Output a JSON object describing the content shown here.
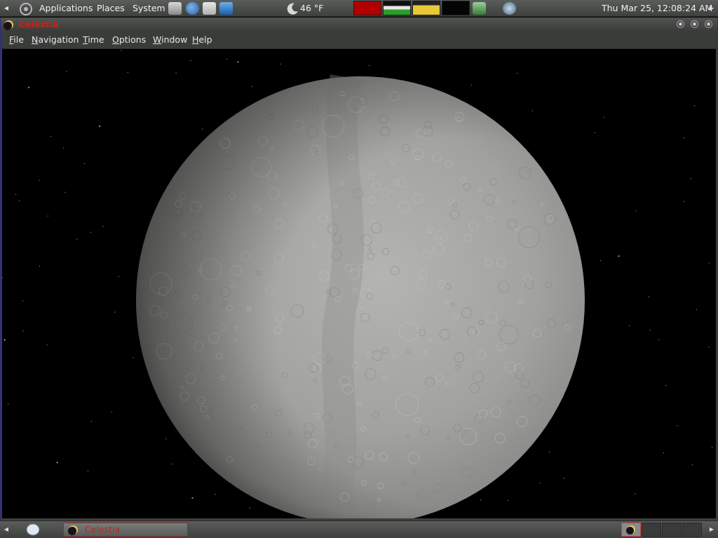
{
  "top_panel": {
    "menus": {
      "applications": "Applications",
      "places": "Places",
      "system": "System"
    },
    "weather": "46 °F",
    "clock": "Thu Mar 25, 12:08:24 AM"
  },
  "window": {
    "title": "Celestia",
    "menubar": {
      "file": {
        "m": "F",
        "r": "ile"
      },
      "navigation": {
        "m": "N",
        "r": "avigation"
      },
      "time": {
        "m": "T",
        "r": "ime"
      },
      "options": {
        "m": "O",
        "r": "ptions"
      },
      "window": {
        "m": "W",
        "r": "indow"
      },
      "help": {
        "m": "H",
        "r": "elp"
      }
    }
  },
  "bottom_panel": {
    "task_label": "Celestia"
  },
  "colors": {
    "title_accent": "#c8221a",
    "panel_bg": "#4a4c4a",
    "sky": "#000000"
  }
}
